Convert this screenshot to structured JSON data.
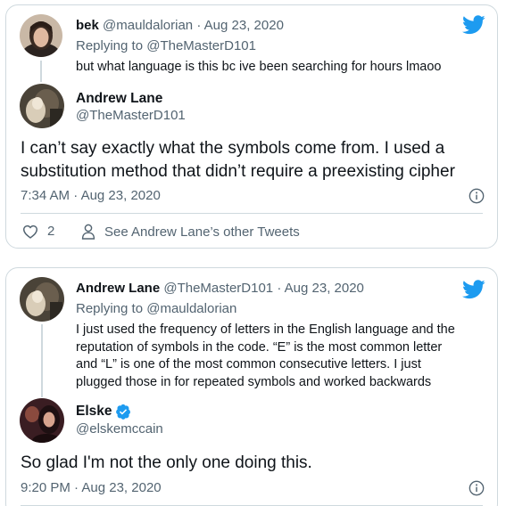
{
  "colors": {
    "twitter_blue": "#1d9bf0",
    "secondary_text": "#536471",
    "border": "#cfd9de",
    "verified_blue": "#1d9bf0"
  },
  "tweet1": {
    "reply": {
      "name": "bek",
      "handle": "@mauldalorian",
      "date": "Aug 23, 2020",
      "replying_to_label": "Replying to",
      "replying_to_handle": "@TheMasterD101",
      "text": "but what language is this bc ive been searching for hours lmaoo"
    },
    "main": {
      "name": "Andrew Lane",
      "handle": "@TheMasterD101",
      "text_line1": "I can’t say exactly what the symbols come from. I used a",
      "text_line2": "substitution method that didn’t require a preexisting cipher",
      "time": "7:34 AM",
      "date": "Aug 23, 2020",
      "likes": "2",
      "other_tweets_label": "See Andrew Lane’s other Tweets"
    }
  },
  "tweet2": {
    "reply": {
      "name": "Andrew Lane",
      "handle": "@TheMasterD101",
      "date": "Aug 23, 2020",
      "replying_to_label": "Replying to",
      "replying_to_handle": "@mauldalorian",
      "text_line1": "I just used the frequency of letters in the English language and the",
      "text_line2": "reputation of symbols in the code. “E” is the most common letter",
      "text_line3": "and “L” is one of the most common consecutive letters. I just",
      "text_line4": "plugged those in for repeated symbols and worked backwards"
    },
    "main": {
      "name": "Elske",
      "handle": "@elskemccain",
      "verified": true,
      "text": "So glad I'm not the only one doing this.",
      "time": "9:20 PM",
      "date": "Aug 23, 2020"
    }
  },
  "separator": "·"
}
